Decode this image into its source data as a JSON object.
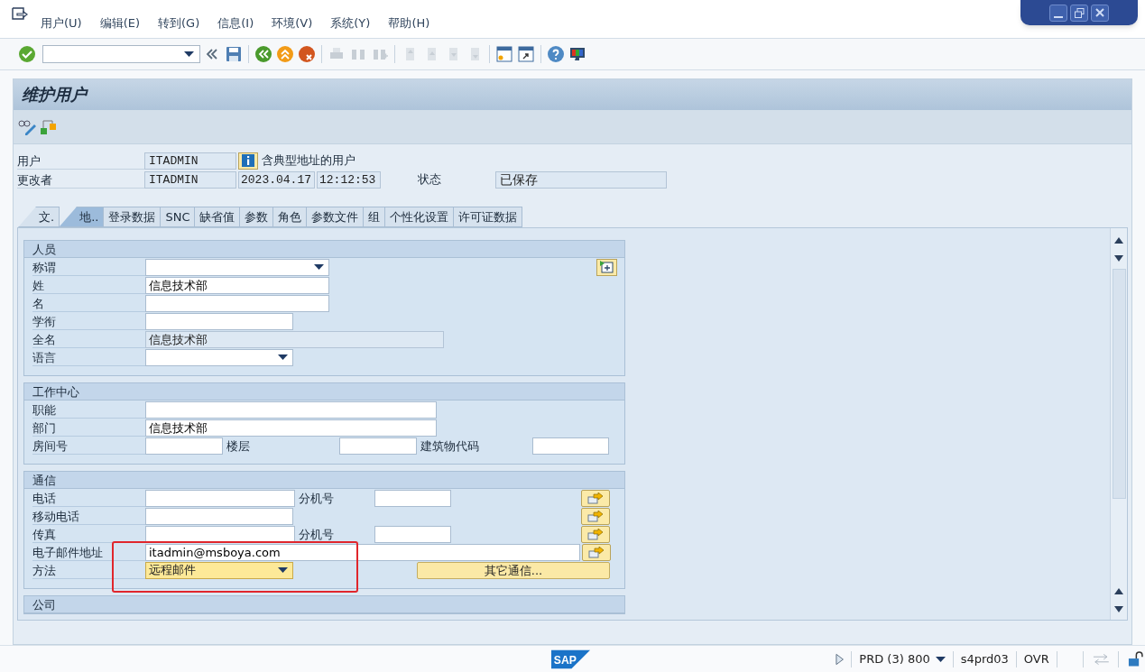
{
  "menu": [
    "用户(U)",
    "编辑(E)",
    "转到(G)",
    "信息(I)",
    "环境(V)",
    "系统(Y)",
    "帮助(H)"
  ],
  "title": "维护用户",
  "header": {
    "user_label": "用户",
    "user": "ITADMIN",
    "user_note": "含典型地址的用户",
    "changed_by_label": "更改者",
    "changed_by": "ITADMIN",
    "date": "2023.04.17",
    "time": "12:12:53",
    "status_label": "状态",
    "status": "已保存"
  },
  "tabs": [
    {
      "label": "文.",
      "selected": false
    },
    {
      "label": "地..",
      "selected": true
    },
    {
      "label": "登录数据",
      "selected": false
    },
    {
      "label": "SNC",
      "selected": false
    },
    {
      "label": "缺省值",
      "selected": false
    },
    {
      "label": "参数",
      "selected": false
    },
    {
      "label": "角色",
      "selected": false
    },
    {
      "label": "参数文件",
      "selected": false
    },
    {
      "label": "组",
      "selected": false
    },
    {
      "label": "个性化设置",
      "selected": false
    },
    {
      "label": "许可证数据",
      "selected": false
    }
  ],
  "groups": [
    {
      "title": "人员",
      "rows": [
        [
          {
            "kind": "label",
            "text": "称谓"
          },
          {
            "kind": "dropdown",
            "highlighted": false
          },
          {
            "kind": "add-button"
          }
        ],
        [
          {
            "kind": "label",
            "text": "姓"
          },
          {
            "kind": "input",
            "value": "信息技术部"
          }
        ],
        [
          {
            "kind": "label",
            "text": "名"
          },
          {
            "kind": "input"
          }
        ],
        [
          {
            "kind": "label",
            "text": "学衔"
          },
          {
            "kind": "input"
          }
        ],
        [
          {
            "kind": "label",
            "text": "全名"
          },
          {
            "kind": "display",
            "value": "信息技术部"
          }
        ],
        [
          {
            "kind": "label",
            "text": "语言"
          },
          {
            "kind": "dropdown",
            "highlighted": false
          }
        ]
      ]
    },
    {
      "title": "工作中心",
      "rows": [
        [
          {
            "kind": "label",
            "text": "职能"
          },
          {
            "kind": "input"
          }
        ],
        [
          {
            "kind": "label",
            "text": "部门"
          },
          {
            "kind": "input",
            "value": "信息技术部"
          }
        ],
        [
          {
            "kind": "label",
            "text": "房间号"
          },
          {
            "kind": "input"
          },
          {
            "kind": "text",
            "text": "楼层"
          },
          {
            "kind": "input"
          },
          {
            "kind": "text",
            "text": "建筑物代码"
          },
          {
            "kind": "input"
          }
        ]
      ]
    },
    {
      "title": "通信",
      "rows": [
        [
          {
            "kind": "label",
            "text": "电话"
          },
          {
            "kind": "input"
          },
          {
            "kind": "text",
            "text": "分机号"
          },
          {
            "kind": "input"
          },
          {
            "kind": "action-button"
          }
        ],
        [
          {
            "kind": "label",
            "text": "移动电话"
          },
          {
            "kind": "input"
          },
          {
            "kind": "action-button"
          }
        ],
        [
          {
            "kind": "label",
            "text": "传真"
          },
          {
            "kind": "input"
          },
          {
            "kind": "text",
            "text": "分机号"
          },
          {
            "kind": "input"
          },
          {
            "kind": "action-button"
          }
        ],
        [
          {
            "kind": "label",
            "text": "电子邮件地址"
          },
          {
            "kind": "input",
            "value": "itadmin@msboya.com"
          },
          {
            "kind": "action-button"
          }
        ],
        [
          {
            "kind": "label",
            "text": "方法"
          },
          {
            "kind": "dropdown",
            "value": "远程邮件",
            "highlighted": true
          },
          {
            "kind": "button",
            "text": "其它通信..."
          }
        ]
      ]
    },
    {
      "title": "公司"
    }
  ],
  "status_bar": {
    "logo": "SAP",
    "system": "PRD (3) 800",
    "server": "s4prd03",
    "mode": "OVR"
  }
}
